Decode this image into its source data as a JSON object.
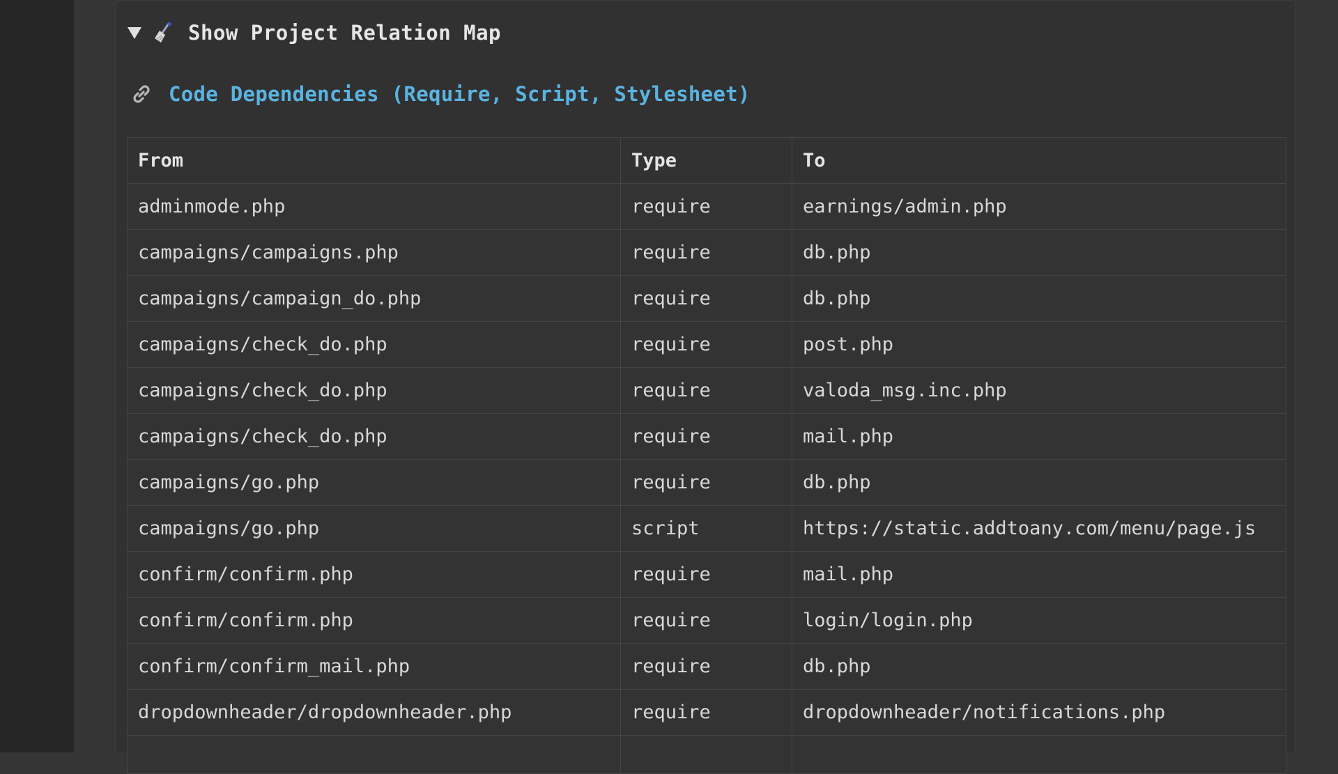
{
  "summary": {
    "label": "Show Project Relation Map",
    "expanded_icon": "triangle-down-icon",
    "icon": "broom-icon"
  },
  "section": {
    "title": "Code Dependencies (Require, Script, Stylesheet)",
    "icon": "link-icon",
    "title_color": "#5ab3e0"
  },
  "table": {
    "headers": [
      "From",
      "Type",
      "To"
    ],
    "rows": [
      [
        "adminmode.php",
        "require",
        "earnings/admin.php"
      ],
      [
        "campaigns/campaigns.php",
        "require",
        "db.php"
      ],
      [
        "campaigns/campaign_do.php",
        "require",
        "db.php"
      ],
      [
        "campaigns/check_do.php",
        "require",
        "post.php"
      ],
      [
        "campaigns/check_do.php",
        "require",
        "valoda_msg.inc.php"
      ],
      [
        "campaigns/check_do.php",
        "require",
        "mail.php"
      ],
      [
        "campaigns/go.php",
        "require",
        "db.php"
      ],
      [
        "campaigns/go.php",
        "script",
        "https://static.addtoany.com/menu/page.js"
      ],
      [
        "confirm/confirm.php",
        "require",
        "mail.php"
      ],
      [
        "confirm/confirm.php",
        "require",
        "login/login.php"
      ],
      [
        "confirm/confirm_mail.php",
        "require",
        "db.php"
      ],
      [
        "dropdownheader/dropdownheader.php",
        "require",
        "dropdownheader/notifications.php"
      ]
    ]
  }
}
